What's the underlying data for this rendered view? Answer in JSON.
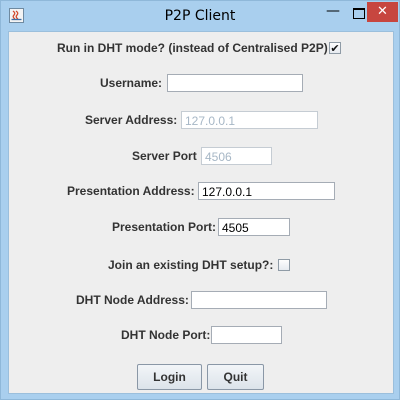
{
  "window": {
    "title": "P2P Client",
    "minimize_glyph": "—",
    "close_glyph": "✕"
  },
  "form": {
    "dht_mode": {
      "label": "Run in DHT mode? (instead of Centralised P2P)",
      "checked": true,
      "check_glyph": "✔"
    },
    "username": {
      "label": "Username:",
      "value": ""
    },
    "server_address": {
      "label": "Server Address:",
      "value": "127.0.0.1",
      "disabled": true
    },
    "server_port": {
      "label": "Server Port",
      "value": "4506",
      "disabled": true
    },
    "presentation_address": {
      "label": "Presentation Address:",
      "value": "127.0.0.1"
    },
    "presentation_port": {
      "label": "Presentation Port:",
      "value": "4505"
    },
    "join_dht": {
      "label": "Join an existing DHT setup?:",
      "checked": false
    },
    "dht_node_address": {
      "label": "DHT Node Address:",
      "value": ""
    },
    "dht_node_port": {
      "label": "DHT Node Port:",
      "value": ""
    }
  },
  "buttons": {
    "login": "Login",
    "quit": "Quit"
  },
  "colors": {
    "titlebar": "#a9cfee",
    "panel": "#eeeeee",
    "close_button": "#c7463f",
    "disabled_text": "#a7b7c6"
  }
}
